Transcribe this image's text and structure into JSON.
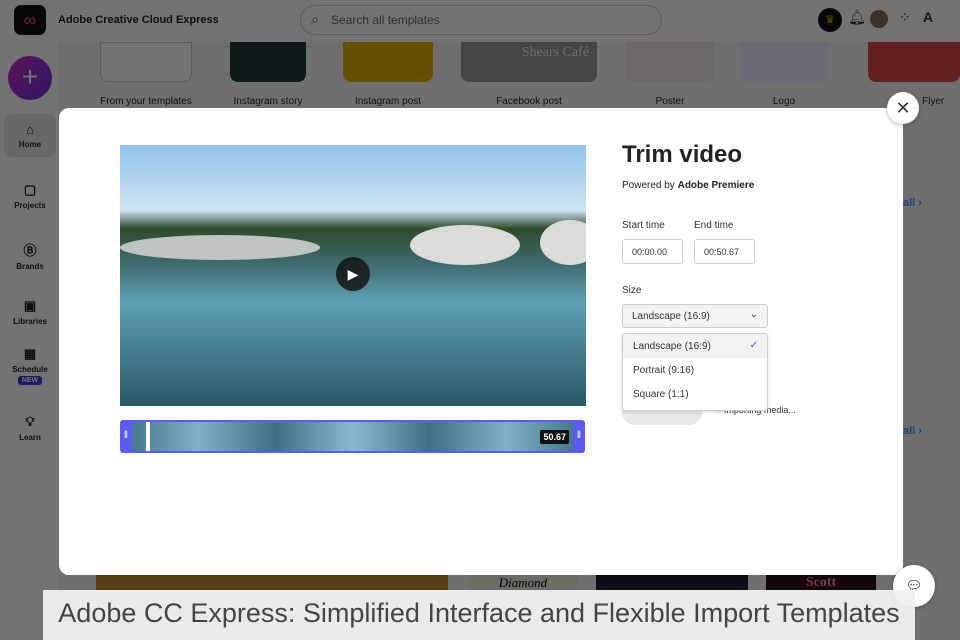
{
  "app": {
    "title": "Adobe Creative Cloud Express",
    "search_placeholder": "Search all templates"
  },
  "sidebar": {
    "items": [
      {
        "label": "Home"
      },
      {
        "label": "Projects"
      },
      {
        "label": "Brands"
      },
      {
        "label": "Libraries"
      },
      {
        "label": "Schedule",
        "badge": "NEW"
      },
      {
        "label": "Learn"
      }
    ]
  },
  "templates": [
    "From your templates",
    "Instagram story",
    "Instagram post",
    "Facebook post",
    "Poster",
    "Logo",
    "Flyer"
  ],
  "background": {
    "see_all": "all ›",
    "shears": "Shears Café",
    "diamond": "Diamond",
    "scott": "Scott"
  },
  "modal": {
    "title": "Trim video",
    "powered_prefix": "Powered by ",
    "powered_brand": "Adobe Premiere",
    "start_label": "Start time",
    "start_value": "00:00.00",
    "end_label": "End time",
    "end_value": "00:50.67",
    "size_label": "Size",
    "size_selected": "Landscape (16:9)",
    "size_options": [
      "Landscape (16:9)",
      "Portrait (9:16)",
      "Square (1:1)"
    ],
    "importing": "Importing media...",
    "duration_badge": "50.67"
  },
  "caption": "Adobe CC Express: Simplified Interface and Flexible Import Templates",
  "colors": {
    "accent": "#5b5bf0",
    "brand_plus": "#9b2fd0"
  }
}
